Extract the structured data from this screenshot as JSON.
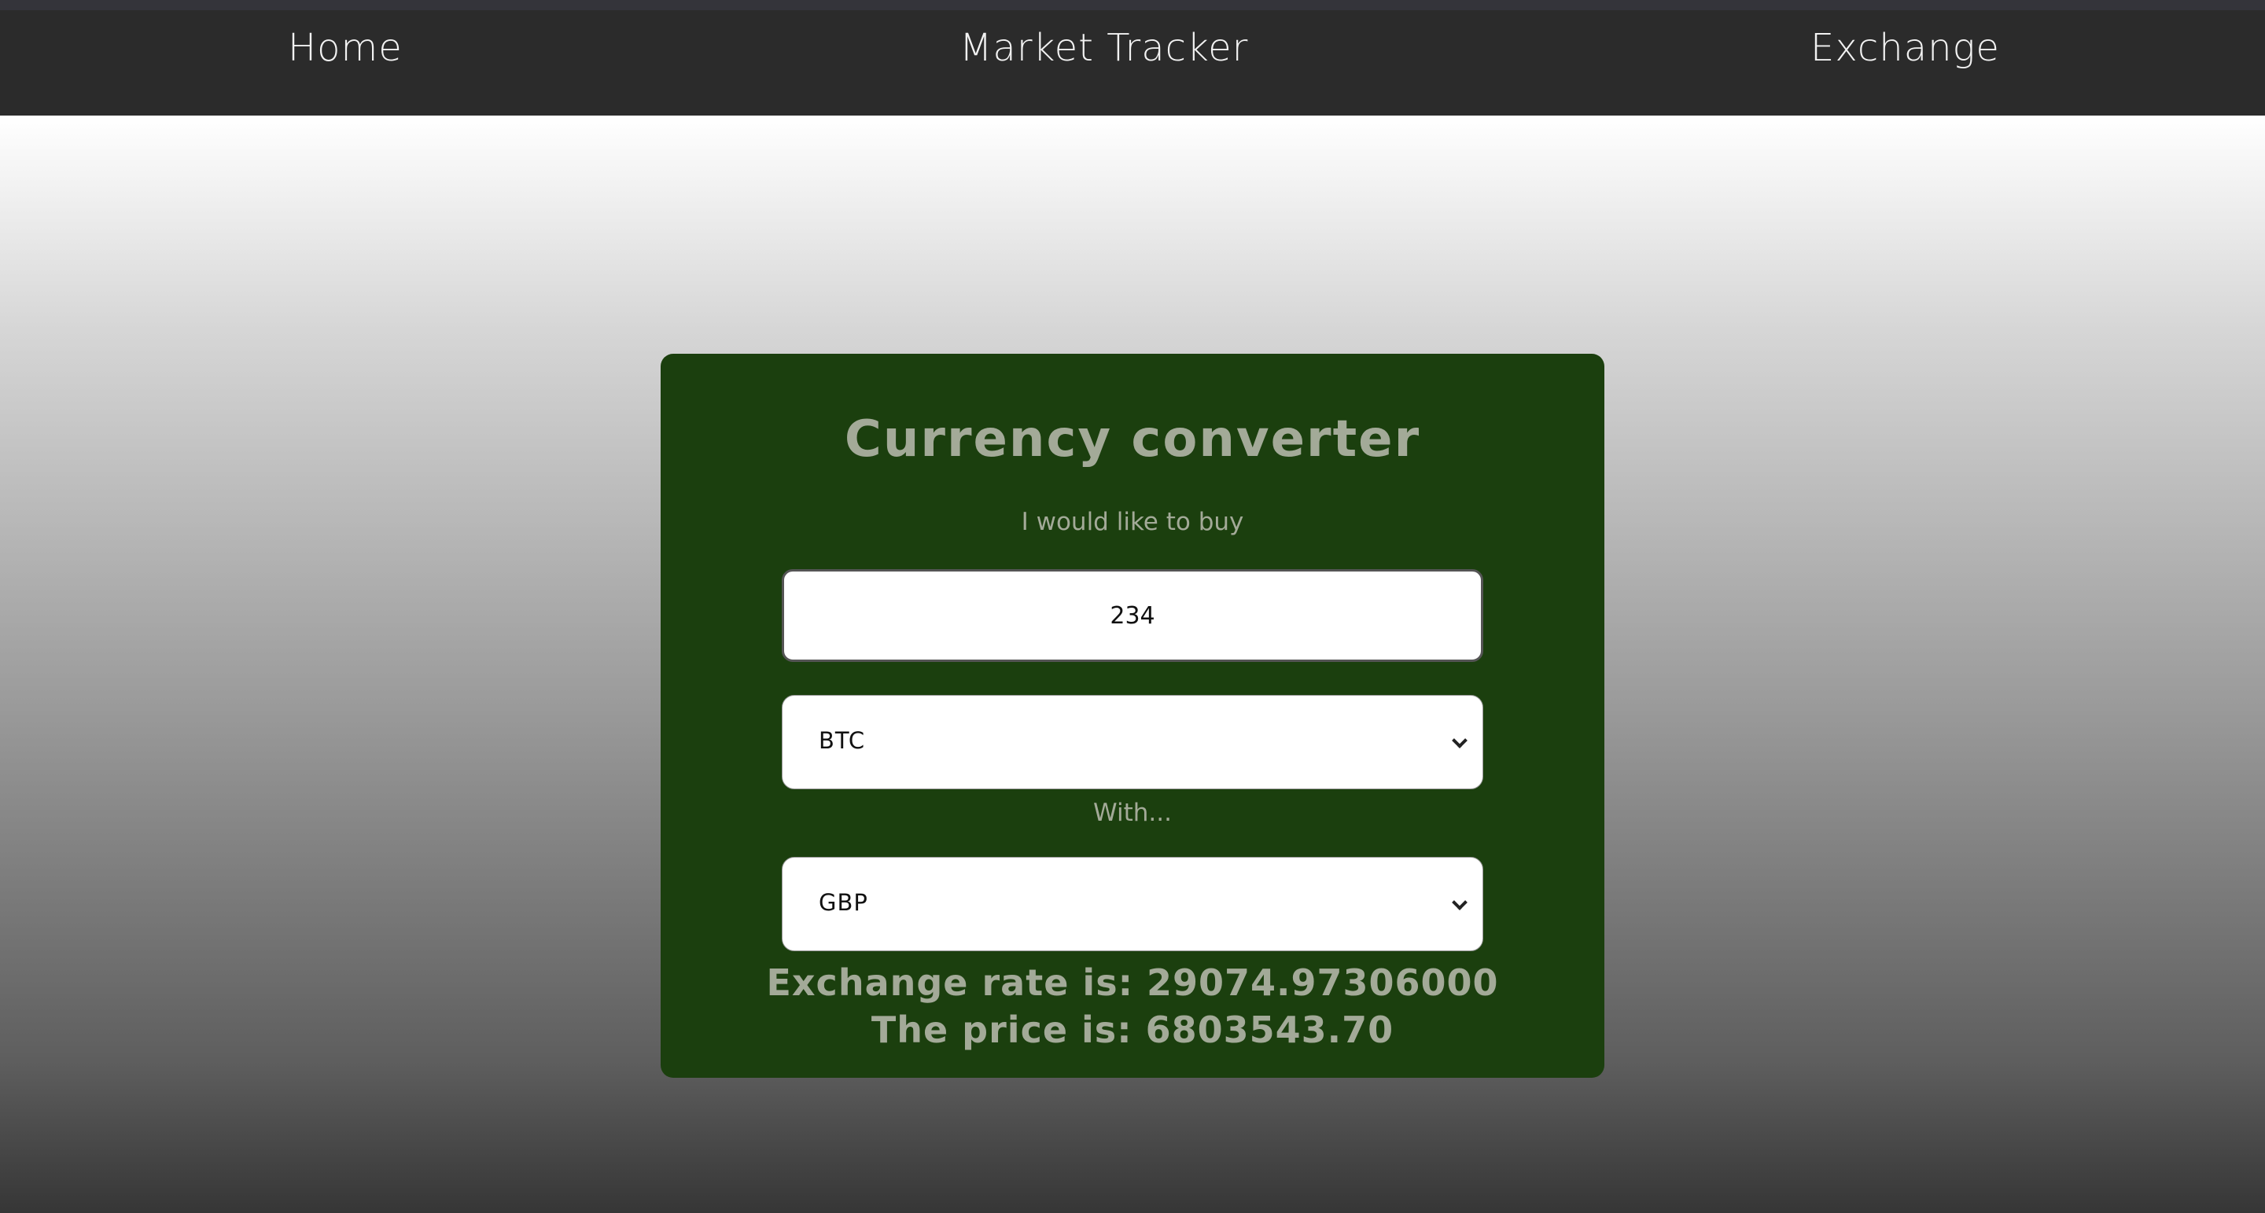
{
  "nav": {
    "home": "Home",
    "market_tracker": "Market Tracker",
    "exchange": "Exchange"
  },
  "converter": {
    "title": "Currency converter",
    "buy_label": "I would like to buy",
    "amount_value": "234",
    "buy_currency": "BTC",
    "with_label": "With...",
    "pay_currency": "GBP",
    "exchange_rate_text": "Exchange rate is: 29074.97306000",
    "price_text": "The price is: 6803543.70"
  },
  "colors": {
    "nav_background": "#2b2b2b",
    "card_background": "#1b3f0e",
    "card_text": "#a3aa98"
  }
}
